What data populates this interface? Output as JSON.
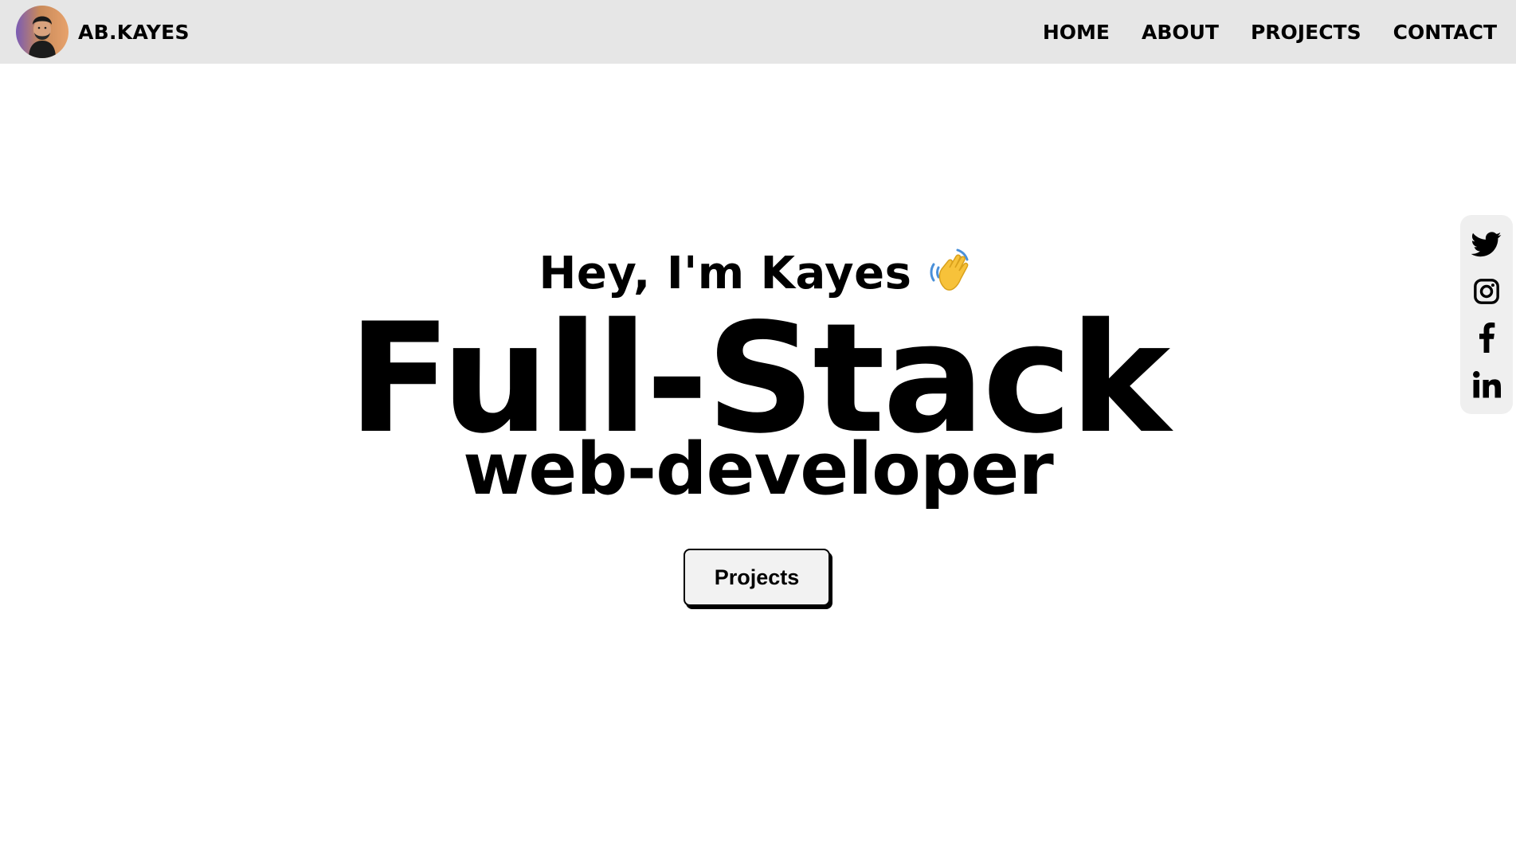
{
  "header": {
    "brand_name": "AB.KAYES",
    "avatar_icon": "person-avatar",
    "nav": [
      {
        "label": "HOME"
      },
      {
        "label": "ABOUT"
      },
      {
        "label": "PROJECTS"
      },
      {
        "label": "CONTACT"
      }
    ]
  },
  "hero": {
    "greeting": "Hey, I'm Kayes",
    "greeting_icon": "waving-hand-icon",
    "headline": "Full-Stack",
    "subheadline": "web-developer",
    "cta_label": "Projects"
  },
  "social": {
    "icons": [
      "twitter-icon",
      "instagram-icon",
      "facebook-icon",
      "linkedin-icon"
    ]
  },
  "colors": {
    "header_bg": "#e6e6e6",
    "page_bg": "#ffffff",
    "text": "#000000",
    "button_bg": "#f2f2f2",
    "social_bar_bg": "#efefef",
    "wave_hand": "#f7c23a"
  }
}
